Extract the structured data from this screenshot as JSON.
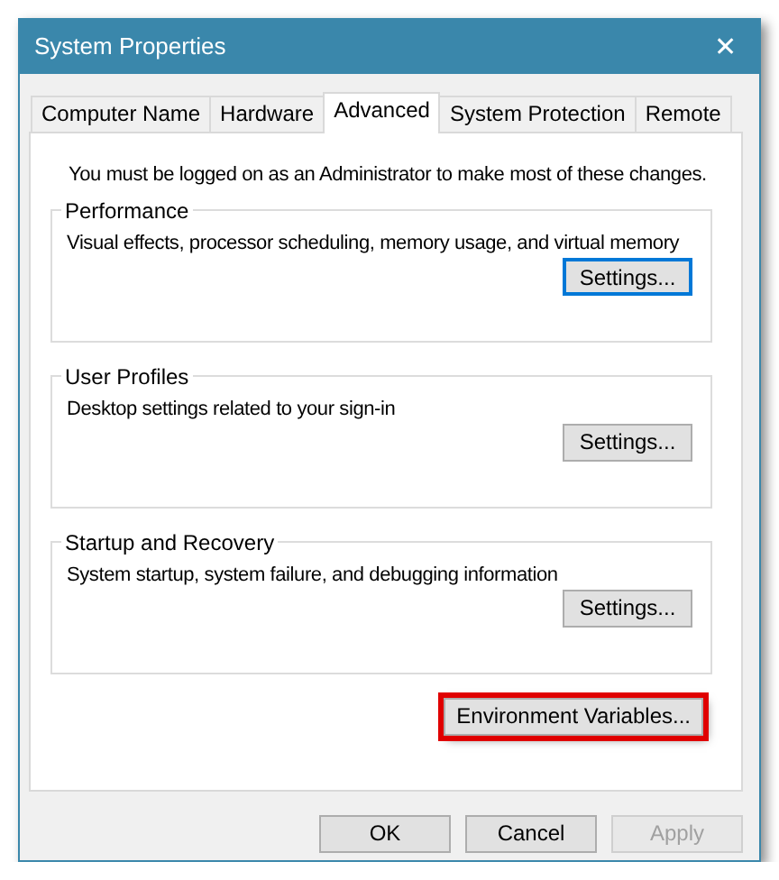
{
  "window": {
    "title": "System Properties",
    "close": "✕"
  },
  "tabs": [
    {
      "label": "Computer Name",
      "selected": false
    },
    {
      "label": "Hardware",
      "selected": false
    },
    {
      "label": "Advanced",
      "selected": true
    },
    {
      "label": "System Protection",
      "selected": false
    },
    {
      "label": "Remote",
      "selected": false
    }
  ],
  "notice": "You must be logged on as an Administrator to make most of these changes.",
  "groups": [
    {
      "title": "Performance",
      "description": "Visual effects, processor scheduling, memory usage, and virtual memory",
      "button": {
        "label": "Settings...",
        "focused": true
      }
    },
    {
      "title": "User Profiles",
      "description": "Desktop settings related to your sign-in",
      "button": {
        "label": "Settings...",
        "focused": false
      }
    },
    {
      "title": "Startup and Recovery",
      "description": "System startup, system failure, and debugging information",
      "button": {
        "label": "Settings...",
        "focused": false
      }
    }
  ],
  "environment_button": {
    "label": "Environment Variables...",
    "highlighted": true
  },
  "buttons": [
    {
      "label": "OK",
      "disabled": false
    },
    {
      "label": "Cancel",
      "disabled": false
    },
    {
      "label": "Apply",
      "disabled": true
    }
  ]
}
